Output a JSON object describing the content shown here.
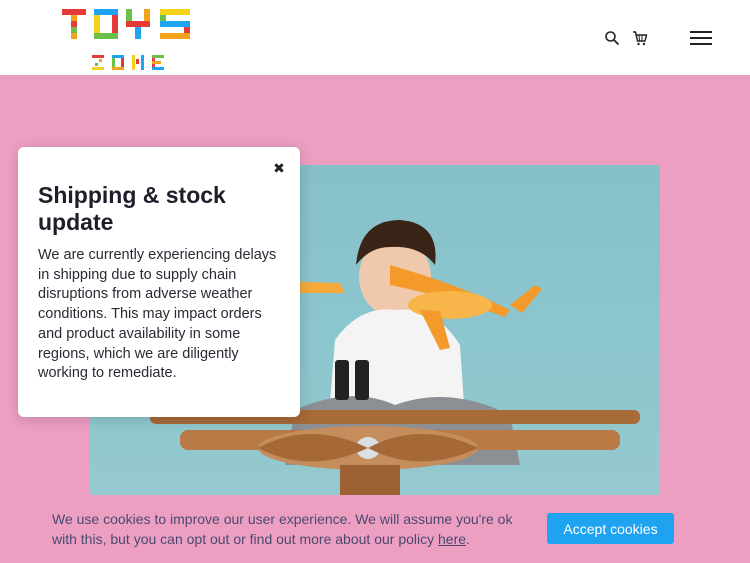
{
  "header": {
    "logo": {
      "top_text": "TOYS",
      "bottom_text": "ZONE"
    },
    "icons": [
      "search-icon",
      "cart-icon",
      "hamburger-menu-icon"
    ]
  },
  "hero": {
    "image": "child-with-toy-airplane-photo"
  },
  "popup": {
    "title": "Shipping & stock update",
    "body": "We are currently experiencing delays in shipping due to supply chain disruptions from adverse weather conditions. This may impact orders and product availability in some regions, which we are diligently working to remediate.",
    "close_symbol": "✖"
  },
  "cookie_bar": {
    "text": "We use cookies to improve our user experience. We will assume you're ok with this, but you can opt out or find out more about our policy",
    "link_text": "here",
    "after_link": ".",
    "accept_label": "Accept cookies"
  },
  "colors": {
    "background": "#ed9fc2",
    "accent_button": "#1ea3f0",
    "hero_backdrop": "#8cc6ce"
  }
}
